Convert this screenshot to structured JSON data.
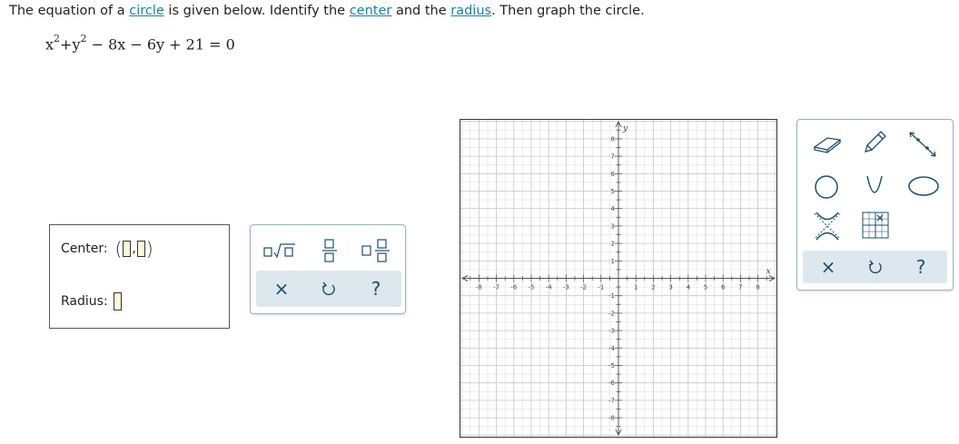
{
  "prompt": {
    "part1": "The equation of a ",
    "link_circle": "circle",
    "part2": " is given below. Identify the ",
    "link_center": "center",
    "part3": " and the ",
    "link_radius": "radius",
    "part4": ". Then graph the circle."
  },
  "equation": {
    "x": "x",
    "exp1": "2",
    "plus_y": "+y",
    "exp2": "2",
    "rest": " − 8x − 6y + 21 = 0"
  },
  "answer": {
    "center_label": "Center:",
    "radius_label": "Radius:",
    "open_paren": "(",
    "comma": ",",
    "close_paren": ")"
  },
  "keypad": {
    "buttons": [
      "square-root",
      "fraction",
      "mixed-number",
      "clear",
      "undo",
      "help"
    ],
    "clear_glyph": "×",
    "help_glyph": "?"
  },
  "graph": {
    "x_axis_label": "x",
    "y_axis_label": "y",
    "x_min": -8,
    "x_max": 8,
    "y_min": -8,
    "y_max": 8,
    "tick_labels_x": [
      "-8",
      "-7",
      "-6",
      "-5",
      "-4",
      "-3",
      "-2",
      "-1",
      "1",
      "2",
      "3",
      "4",
      "5",
      "6",
      "7",
      "8"
    ],
    "tick_labels_y": [
      "8",
      "7",
      "6",
      "5",
      "4",
      "3",
      "2",
      "1",
      "-1",
      "-2",
      "-3",
      "-4",
      "-5",
      "-6",
      "-7",
      "-8"
    ]
  },
  "tools": {
    "items": [
      "eraser",
      "pencil",
      "line",
      "circle",
      "parabola",
      "ellipse",
      "hyperbola",
      "point-plot"
    ],
    "clear_glyph": "×",
    "help_glyph": "?"
  },
  "colors": {
    "link": "#1a7fa8",
    "input_fill": "#fff8d6",
    "panel_border": "#9ab3c4",
    "panel_bar": "#dde7ee",
    "icon": "#1b4f68",
    "grid": "#d9d9d9"
  }
}
